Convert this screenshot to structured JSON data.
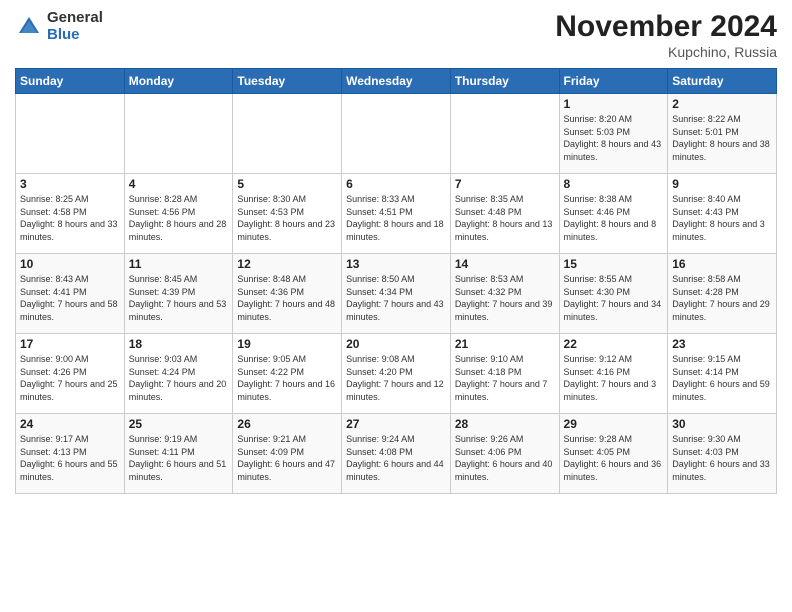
{
  "logo": {
    "general": "General",
    "blue": "Blue"
  },
  "title": "November 2024",
  "location": "Kupchino, Russia",
  "headers": [
    "Sunday",
    "Monday",
    "Tuesday",
    "Wednesday",
    "Thursday",
    "Friday",
    "Saturday"
  ],
  "weeks": [
    [
      {
        "day": "",
        "info": ""
      },
      {
        "day": "",
        "info": ""
      },
      {
        "day": "",
        "info": ""
      },
      {
        "day": "",
        "info": ""
      },
      {
        "day": "",
        "info": ""
      },
      {
        "day": "1",
        "info": "Sunrise: 8:20 AM\nSunset: 5:03 PM\nDaylight: 8 hours and 43 minutes."
      },
      {
        "day": "2",
        "info": "Sunrise: 8:22 AM\nSunset: 5:01 PM\nDaylight: 8 hours and 38 minutes."
      }
    ],
    [
      {
        "day": "3",
        "info": "Sunrise: 8:25 AM\nSunset: 4:58 PM\nDaylight: 8 hours and 33 minutes."
      },
      {
        "day": "4",
        "info": "Sunrise: 8:28 AM\nSunset: 4:56 PM\nDaylight: 8 hours and 28 minutes."
      },
      {
        "day": "5",
        "info": "Sunrise: 8:30 AM\nSunset: 4:53 PM\nDaylight: 8 hours and 23 minutes."
      },
      {
        "day": "6",
        "info": "Sunrise: 8:33 AM\nSunset: 4:51 PM\nDaylight: 8 hours and 18 minutes."
      },
      {
        "day": "7",
        "info": "Sunrise: 8:35 AM\nSunset: 4:48 PM\nDaylight: 8 hours and 13 minutes."
      },
      {
        "day": "8",
        "info": "Sunrise: 8:38 AM\nSunset: 4:46 PM\nDaylight: 8 hours and 8 minutes."
      },
      {
        "day": "9",
        "info": "Sunrise: 8:40 AM\nSunset: 4:43 PM\nDaylight: 8 hours and 3 minutes."
      }
    ],
    [
      {
        "day": "10",
        "info": "Sunrise: 8:43 AM\nSunset: 4:41 PM\nDaylight: 7 hours and 58 minutes."
      },
      {
        "day": "11",
        "info": "Sunrise: 8:45 AM\nSunset: 4:39 PM\nDaylight: 7 hours and 53 minutes."
      },
      {
        "day": "12",
        "info": "Sunrise: 8:48 AM\nSunset: 4:36 PM\nDaylight: 7 hours and 48 minutes."
      },
      {
        "day": "13",
        "info": "Sunrise: 8:50 AM\nSunset: 4:34 PM\nDaylight: 7 hours and 43 minutes."
      },
      {
        "day": "14",
        "info": "Sunrise: 8:53 AM\nSunset: 4:32 PM\nDaylight: 7 hours and 39 minutes."
      },
      {
        "day": "15",
        "info": "Sunrise: 8:55 AM\nSunset: 4:30 PM\nDaylight: 7 hours and 34 minutes."
      },
      {
        "day": "16",
        "info": "Sunrise: 8:58 AM\nSunset: 4:28 PM\nDaylight: 7 hours and 29 minutes."
      }
    ],
    [
      {
        "day": "17",
        "info": "Sunrise: 9:00 AM\nSunset: 4:26 PM\nDaylight: 7 hours and 25 minutes."
      },
      {
        "day": "18",
        "info": "Sunrise: 9:03 AM\nSunset: 4:24 PM\nDaylight: 7 hours and 20 minutes."
      },
      {
        "day": "19",
        "info": "Sunrise: 9:05 AM\nSunset: 4:22 PM\nDaylight: 7 hours and 16 minutes."
      },
      {
        "day": "20",
        "info": "Sunrise: 9:08 AM\nSunset: 4:20 PM\nDaylight: 7 hours and 12 minutes."
      },
      {
        "day": "21",
        "info": "Sunrise: 9:10 AM\nSunset: 4:18 PM\nDaylight: 7 hours and 7 minutes."
      },
      {
        "day": "22",
        "info": "Sunrise: 9:12 AM\nSunset: 4:16 PM\nDaylight: 7 hours and 3 minutes."
      },
      {
        "day": "23",
        "info": "Sunrise: 9:15 AM\nSunset: 4:14 PM\nDaylight: 6 hours and 59 minutes."
      }
    ],
    [
      {
        "day": "24",
        "info": "Sunrise: 9:17 AM\nSunset: 4:13 PM\nDaylight: 6 hours and 55 minutes."
      },
      {
        "day": "25",
        "info": "Sunrise: 9:19 AM\nSunset: 4:11 PM\nDaylight: 6 hours and 51 minutes."
      },
      {
        "day": "26",
        "info": "Sunrise: 9:21 AM\nSunset: 4:09 PM\nDaylight: 6 hours and 47 minutes."
      },
      {
        "day": "27",
        "info": "Sunrise: 9:24 AM\nSunset: 4:08 PM\nDaylight: 6 hours and 44 minutes."
      },
      {
        "day": "28",
        "info": "Sunrise: 9:26 AM\nSunset: 4:06 PM\nDaylight: 6 hours and 40 minutes."
      },
      {
        "day": "29",
        "info": "Sunrise: 9:28 AM\nSunset: 4:05 PM\nDaylight: 6 hours and 36 minutes."
      },
      {
        "day": "30",
        "info": "Sunrise: 9:30 AM\nSunset: 4:03 PM\nDaylight: 6 hours and 33 minutes."
      }
    ]
  ]
}
